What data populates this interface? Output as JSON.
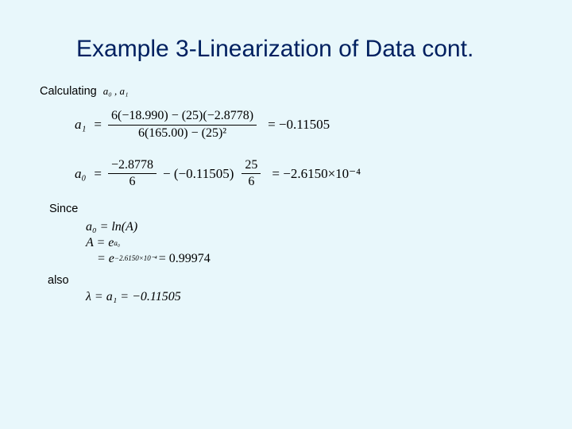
{
  "title": "Example 3-Linearization of Data cont.",
  "labels": {
    "calculating": "Calculating",
    "since": "Since",
    "also": "also"
  },
  "inline": {
    "a0a1": "a₀ , a₁"
  },
  "eq1": {
    "lhs": "a₁",
    "num": "6(−18.990) − (25)(−2.8778)",
    "den": "6(165.00) − (25)²",
    "eq": "=",
    "result": "= −0.11505"
  },
  "eq2": {
    "lhs": "a₀",
    "eq": "=",
    "frac1_num": "−2.8778",
    "frac1_den": "6",
    "mid": " − (−0.11505)",
    "frac2_num": "25",
    "frac2_den": "6",
    "result": "= −2.6150×10⁻⁴"
  },
  "since_block": {
    "l1": "a₀ = ln(A)",
    "l2_lhs": "A = e",
    "l2_exp": "a₀",
    "l3_lhs": "= e",
    "l3_exp": "−2.6150×10⁻⁴",
    "l3_rhs": " = 0.99974"
  },
  "also_block": {
    "line": "λ = a₁ = −0.11505"
  }
}
